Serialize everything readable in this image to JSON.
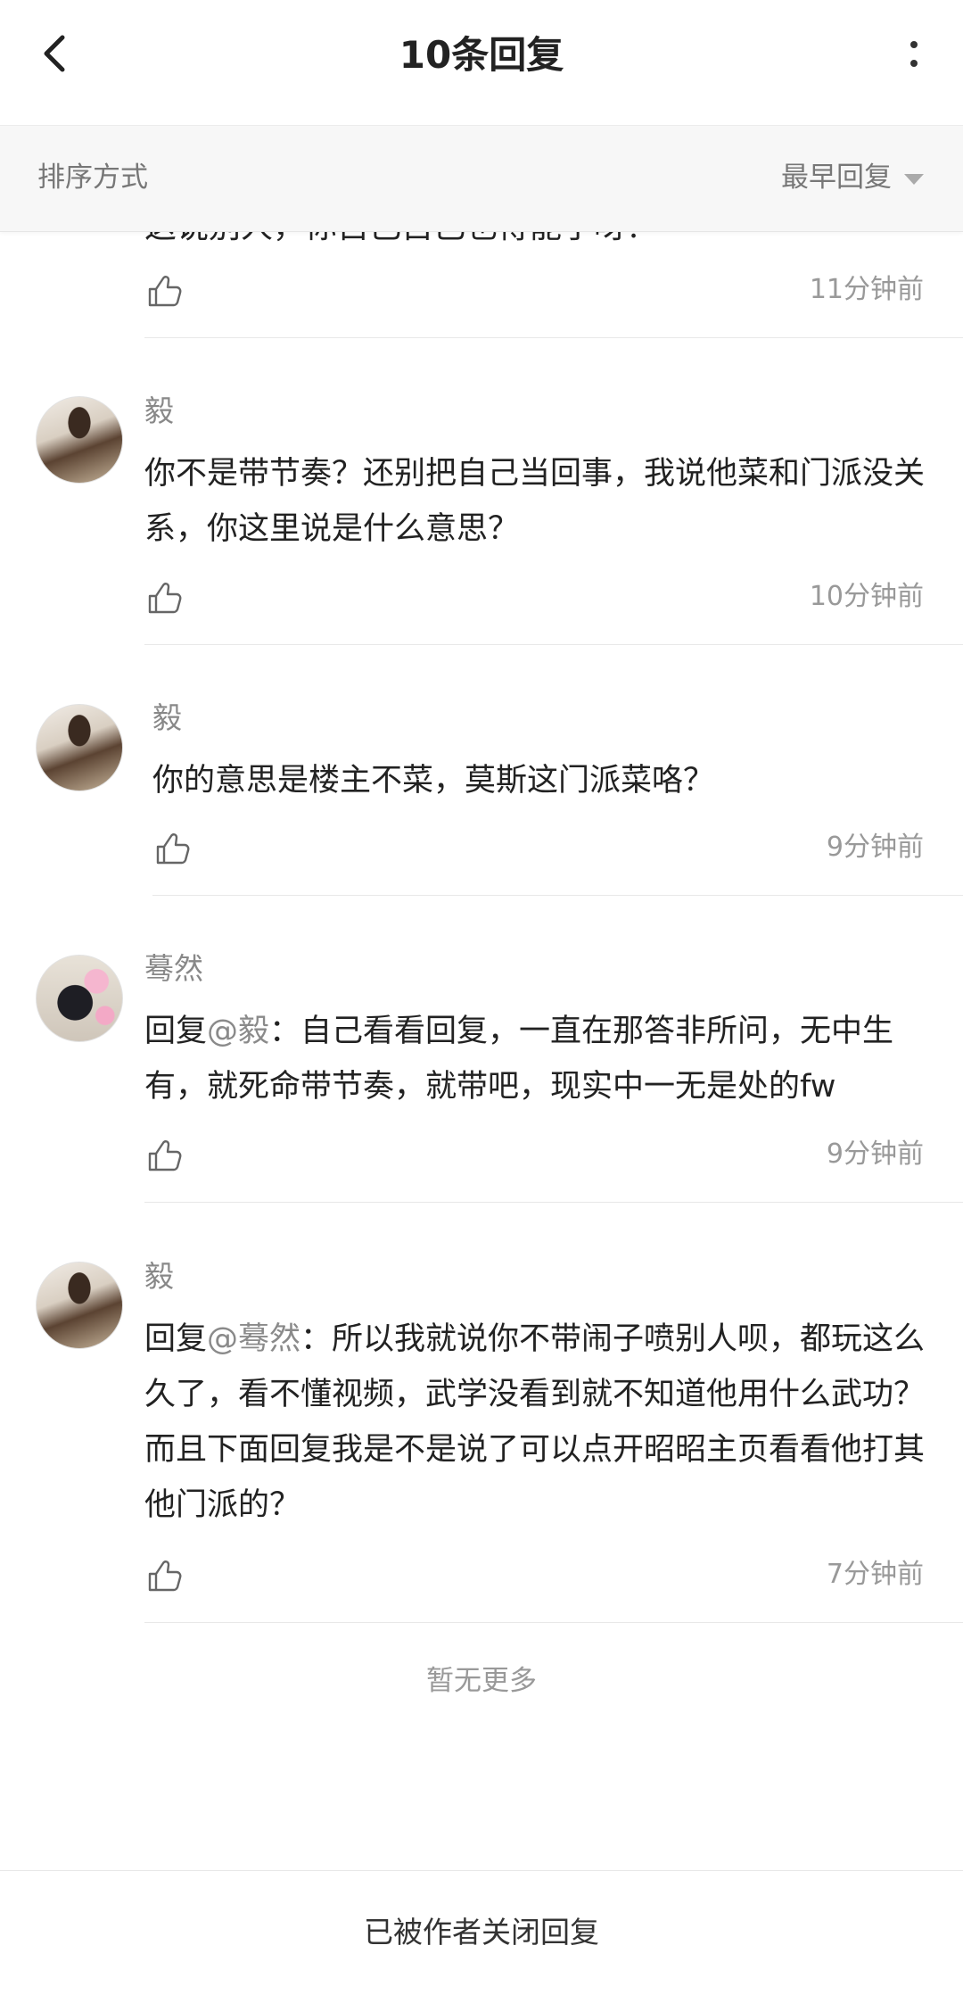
{
  "header": {
    "title": "10条回复"
  },
  "sort": {
    "label": "排序方式",
    "value": "最早回复"
  },
  "top_fragment": {
    "text": "这说别人，你自己自己也得能了呀？",
    "time": "11分钟前"
  },
  "replies": [
    {
      "author": "毅",
      "content": "你不是带节奏？还别把自己当回事，我说他菜和门派没关系，你这里说是什么意思？",
      "time": "10分钟前"
    },
    {
      "author": "毅",
      "content": "你的意思是楼主不菜，莫斯这门派菜咯？",
      "time": "9分钟前"
    },
    {
      "author": "蓦然",
      "prefix": "回复",
      "mention": "@毅",
      "content": "：自己看看回复，一直在那答非所问，无中生有，就死命带节奏，就带吧，现实中一无是处的fw",
      "time": "9分钟前"
    },
    {
      "author": "毅",
      "prefix": "回复",
      "mention": "@蓦然",
      "content": "：所以我就说你不带闹子喷别人呗，都玩这么久了，看不懂视频，武学没看到就不知道他用什么武功？而且下面回复我是不是说了可以点开昭昭主页看看他打其他门派的？",
      "time": "7分钟前"
    }
  ],
  "no_more": "暂无更多",
  "footer": {
    "text": "已被作者关闭回复"
  }
}
